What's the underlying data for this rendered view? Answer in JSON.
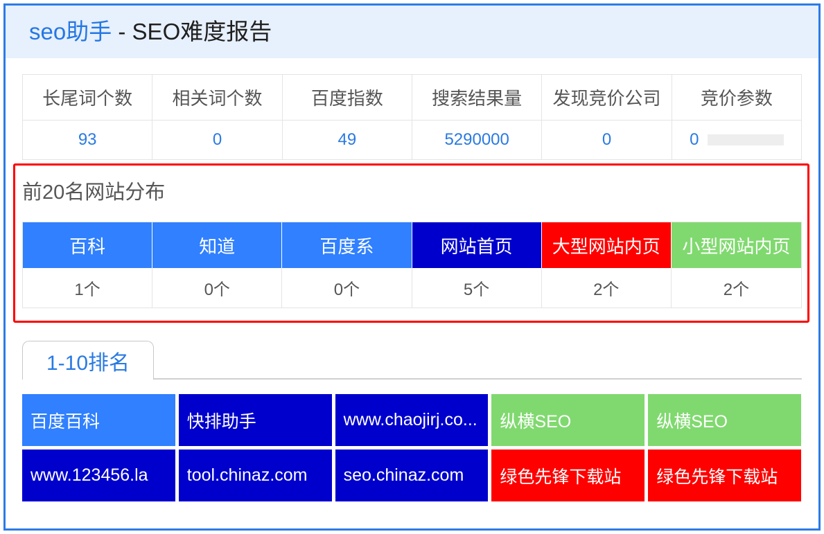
{
  "header": {
    "brand": "seo助手",
    "separator": " - ",
    "title": "SEO难度报告"
  },
  "stats": {
    "headers": [
      "长尾词个数",
      "相关词个数",
      "百度指数",
      "搜索结果量",
      "发现竞价公司",
      "竞价参数"
    ],
    "values": [
      "93",
      "0",
      "49",
      "5290000",
      "0",
      "0"
    ],
    "bid_bar_fill": 0
  },
  "distribution": {
    "title": "前20名网站分布",
    "items": [
      {
        "label": "百科",
        "count": "1个",
        "color": "#3080ff"
      },
      {
        "label": "知道",
        "count": "0个",
        "color": "#3080ff"
      },
      {
        "label": "百度系",
        "count": "0个",
        "color": "#3080ff"
      },
      {
        "label": "网站首页",
        "count": "5个",
        "color": "#0000cd"
      },
      {
        "label": "大型网站内页",
        "count": "2个",
        "color": "#ff0000"
      },
      {
        "label": "小型网站内页",
        "count": "2个",
        "color": "#80d96f"
      }
    ]
  },
  "tabs": [
    {
      "label": "1-10排名",
      "active": true
    }
  ],
  "rankings": [
    {
      "site": "百度百科",
      "color": "#3080ff"
    },
    {
      "site": "快排助手",
      "color": "#0000cd"
    },
    {
      "site": "www.chaojirj.co...",
      "color": "#0000cd"
    },
    {
      "site": "纵横SEO",
      "color": "#80d96f"
    },
    {
      "site": "纵横SEO",
      "color": "#80d96f"
    },
    {
      "site": "www.123456.la",
      "color": "#0000cd"
    },
    {
      "site": "tool.chinaz.com",
      "color": "#0000cd"
    },
    {
      "site": "seo.chinaz.com",
      "color": "#0000cd"
    },
    {
      "site": "绿色先锋下载站",
      "color": "#ff0000"
    },
    {
      "site": "绿色先锋下载站",
      "color": "#ff0000"
    }
  ],
  "theme": {
    "accent": "#2a7ae2",
    "frame_border": "#2c7be5",
    "header_bg": "#e7f0fd",
    "highlight_border": "#ff0000"
  }
}
